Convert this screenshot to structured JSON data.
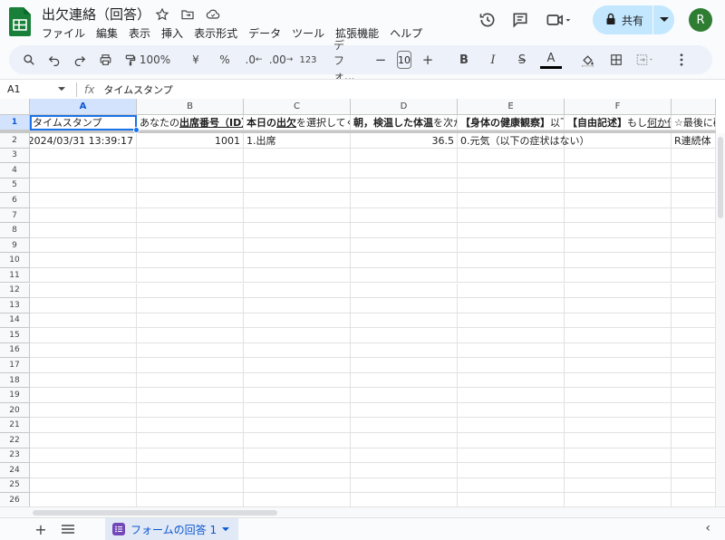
{
  "app": {
    "doc_title": "出欠連絡（回答）",
    "menu": [
      "ファイル",
      "編集",
      "表示",
      "挿入",
      "表示形式",
      "データ",
      "ツール",
      "拡張機能",
      "ヘルプ"
    ],
    "share_label": "共有",
    "avatar_letter": "R"
  },
  "toolbar": {
    "zoom": "100%",
    "currency": "¥",
    "percent": "%",
    "dec_decrease": ".0",
    "dec_increase": ".00",
    "number_format": "123",
    "font": "デフォ...",
    "font_size": "10",
    "minus": "−",
    "plus": "+",
    "bold": "B",
    "italic": "I",
    "strike": "S",
    "text_color": "A"
  },
  "formula_bar": {
    "cell_ref": "A1",
    "fx": "fx",
    "content": "タイムスタンプ"
  },
  "grid": {
    "columns": [
      "A",
      "B",
      "C",
      "D",
      "E",
      "F",
      "G"
    ],
    "rows": [
      "1",
      "2",
      "3",
      "4",
      "5",
      "6",
      "7",
      "8",
      "9",
      "10",
      "11",
      "12",
      "13",
      "14",
      "15",
      "16",
      "17",
      "18",
      "19",
      "20",
      "21",
      "22",
      "23",
      "24",
      "25",
      "26"
    ],
    "headers": {
      "a": "タイムスタンプ",
      "b_pre": "あなたの",
      "b_bold": "出席番号（ID）",
      "c_bold1": "本日の",
      "c_bold2": "出欠",
      "c_rest": "を選択してく",
      "d_bold": "朝，検温した体温",
      "d_rest": "を次か",
      "e_bold": "【身体の健康観察】",
      "e_rest": "以下",
      "f_bold": "【自由記述】",
      "f_rest": "もし",
      "f_link": "何か伝",
      "g": "☆最後に確"
    },
    "row2": {
      "a": "2024/03/31 13:39:17",
      "b": "1001",
      "c": "1.出席",
      "d": "36.5",
      "e": "0.元気（以下の症状はない）",
      "g": "R連続体"
    }
  },
  "bottom": {
    "sheet_tab": "フォームの回答 1"
  },
  "colors": {
    "accent": "#0b57d0",
    "share_bg": "#c2e7ff",
    "toolbar_bg": "#edf2fa",
    "selection": "#1a73e8",
    "sheets_green": "#188038"
  }
}
